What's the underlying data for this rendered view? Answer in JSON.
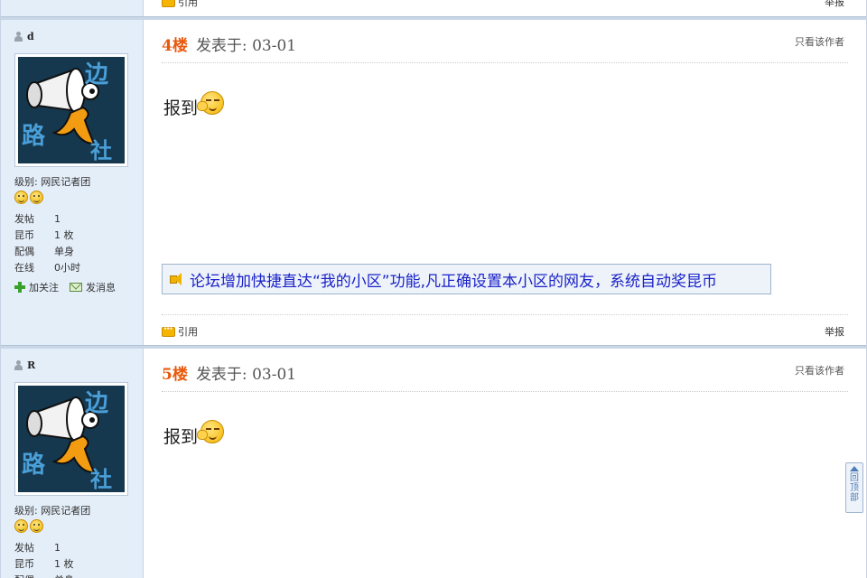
{
  "prev_post": {
    "quote_label": "引用",
    "report_label": "举报"
  },
  "posts": [
    {
      "username": "d",
      "level_label": "级别: 网民记者团",
      "stats": [
        {
          "key": "发帖",
          "value": "1"
        },
        {
          "key": "昆币",
          "value": "1 枚"
        },
        {
          "key": "配偶",
          "value": "单身"
        },
        {
          "key": "在线",
          "value": "0小时"
        }
      ],
      "follow_label": "加关注",
      "message_label": "发消息",
      "floor": "4楼",
      "posted": "发表于: 03-01",
      "only_author": "只看该作者",
      "content": "报到",
      "notice": "论坛增加快捷直达“我的小区”功能,凡正确设置本小区的网友，系统自动奖昆币",
      "quote_label": "引用",
      "report_label": "举报",
      "avatar_text": [
        "边",
        "路",
        "社"
      ]
    },
    {
      "username": "R",
      "level_label": "级别: 网民记者团",
      "stats": [
        {
          "key": "发帖",
          "value": "1"
        },
        {
          "key": "昆币",
          "value": "1 枚"
        },
        {
          "key": "配偶",
          "value": "单身"
        }
      ],
      "floor": "5楼",
      "posted": "发表于: 03-01",
      "only_author": "只看该作者",
      "content": "报到",
      "avatar_text": [
        "边",
        "路",
        "社"
      ]
    }
  ],
  "back_to_top": "回顶部",
  "colors": {
    "floor": "#e8590c",
    "notice_link": "#1a22c8",
    "sidebar_bg": "#e4eef9"
  }
}
